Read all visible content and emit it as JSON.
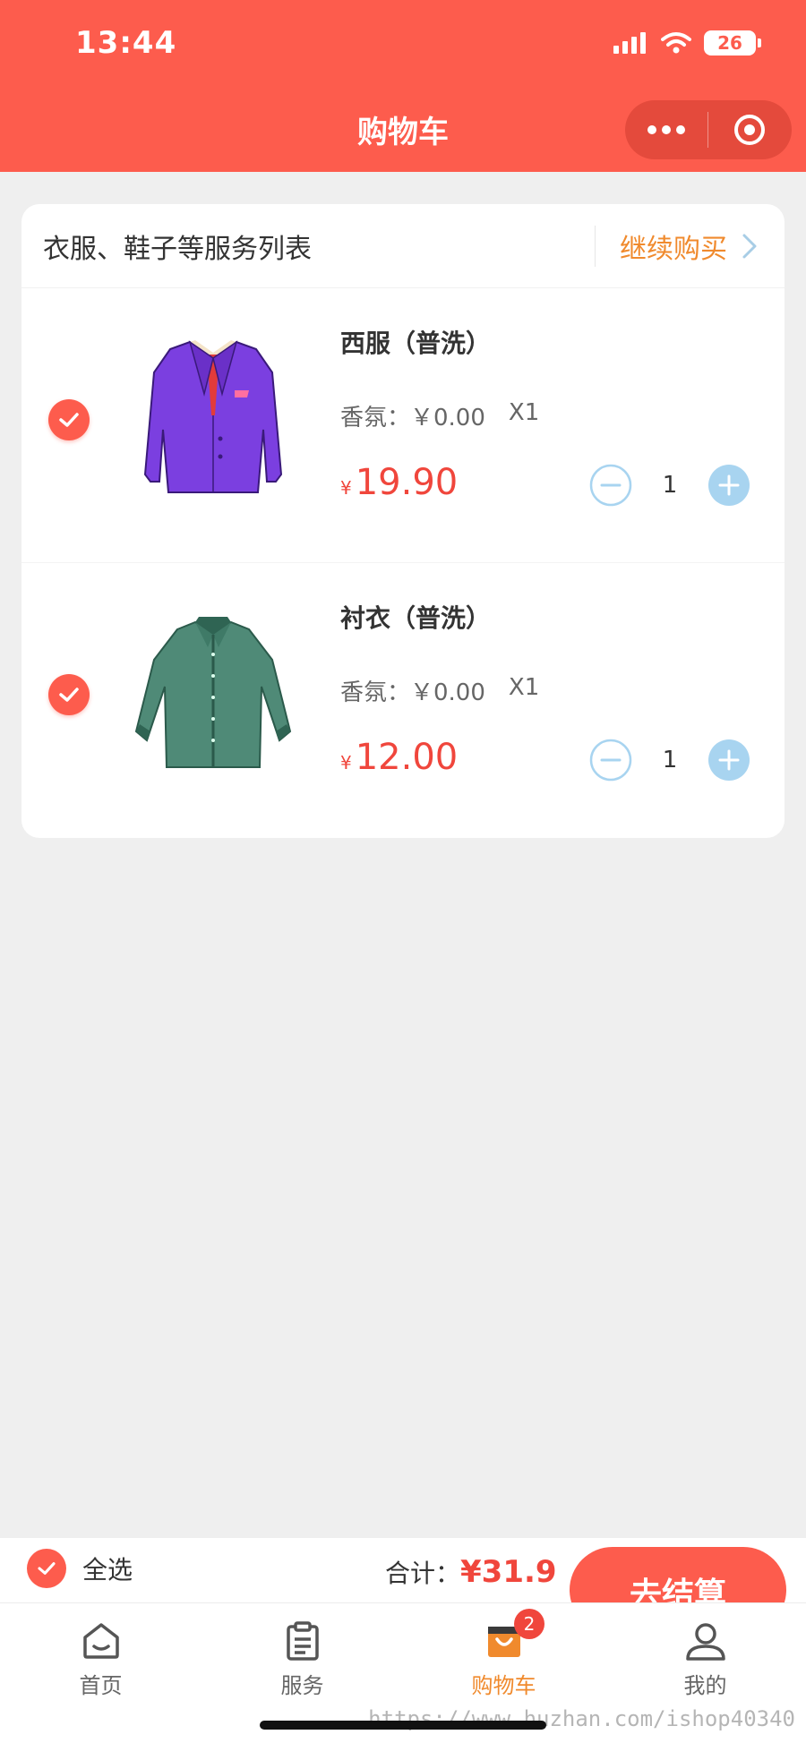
{
  "status_bar": {
    "time": "13:44",
    "battery": "26"
  },
  "nav": {
    "title": "购物车"
  },
  "list": {
    "title": "衣服、鞋子等服务列表",
    "continue_label": "继续购买"
  },
  "items": [
    {
      "name": "西服（普洗）",
      "option": "香氛：￥0.00",
      "multiplier": "X1",
      "currency": "¥",
      "price": "19.90",
      "quantity": "1",
      "checked": true
    },
    {
      "name": "衬衣（普洗）",
      "option": "香氛：￥0.00",
      "multiplier": "X1",
      "currency": "¥",
      "price": "12.00",
      "quantity": "1",
      "checked": true
    }
  ],
  "checkout": {
    "select_all_label": "全选",
    "total_label": "合计：",
    "total_value": "¥31.9",
    "button_label": "去结算"
  },
  "tabbar": {
    "items": [
      {
        "label": "首页",
        "icon": "home-icon"
      },
      {
        "label": "服务",
        "icon": "clipboard-icon"
      },
      {
        "label": "购物车",
        "icon": "shopping-bag-icon",
        "badge": "2",
        "active": true
      },
      {
        "label": "我的",
        "icon": "user-icon"
      }
    ]
  },
  "watermark": "https://www.huzhan.com/ishop40340",
  "colors": {
    "primary": "#fd5c4d",
    "accent_orange": "#f08a2d",
    "price_red": "#f0463c",
    "stepper_blue": "#a8d4f0"
  }
}
